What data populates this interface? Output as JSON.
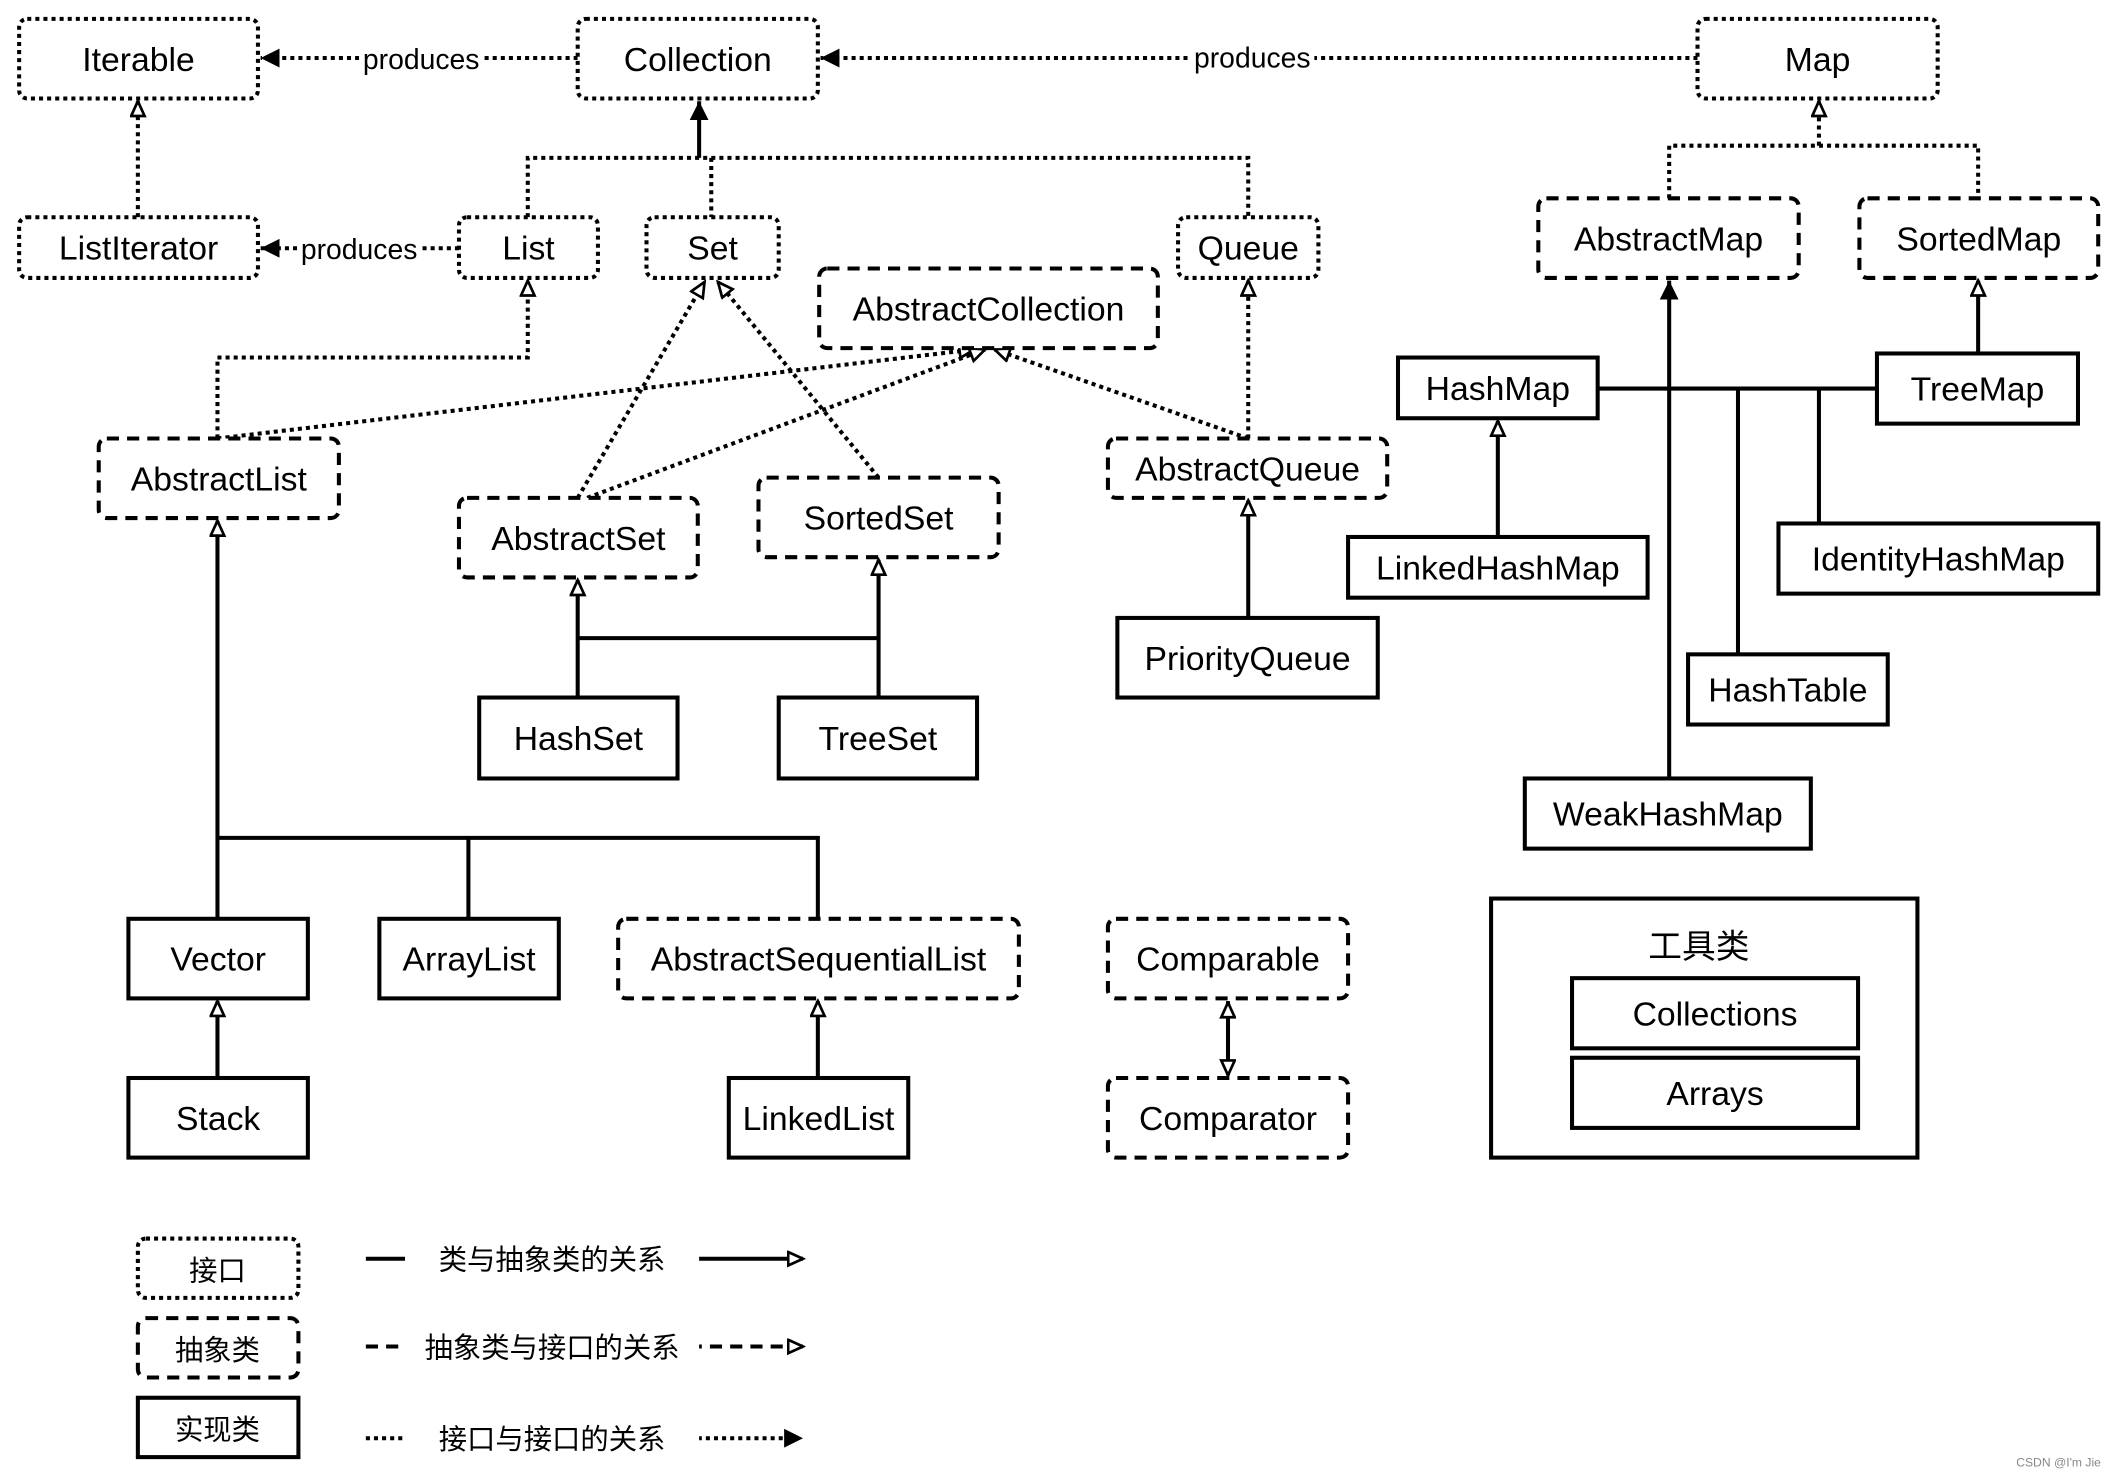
{
  "nodes": {
    "iterable": "Iterable",
    "collection": "Collection",
    "map": "Map",
    "listiterator": "ListIterator",
    "list": "List",
    "set": "Set",
    "queue": "Queue",
    "abstractcollection": "AbstractCollection",
    "abstractmap": "AbstractMap",
    "sortedmap": "SortedMap",
    "hashmap": "HashMap",
    "treemap": "TreeMap",
    "abstractlist": "AbstractList",
    "abstractset": "AbstractSet",
    "sortedset": "SortedSet",
    "abstractqueue": "AbstractQueue",
    "linkedhashmap": "LinkedHashMap",
    "identityhashmap": "IdentityHashMap",
    "priorityqueue": "PriorityQueue",
    "hashtable": "HashTable",
    "hashset": "HashSet",
    "treeset": "TreeSet",
    "weakhashmap": "WeakHashMap",
    "vector": "Vector",
    "arraylist": "ArrayList",
    "abstractsequentiallist": "AbstractSequentialList",
    "comparable": "Comparable",
    "stack": "Stack",
    "linkedlist": "LinkedList",
    "comparator": "Comparator",
    "collections": "Collections",
    "arrays": "Arrays"
  },
  "utility_group_title": "工具类",
  "edge_labels": {
    "collection_iterable": "produces",
    "map_collection": "produces",
    "list_listiterator": "produces"
  },
  "legend": {
    "interface": "接口",
    "abstract_class": "抽象类",
    "impl_class": "实现类",
    "class_abstract_relation": "类与抽象类的关系",
    "abstract_interface_relation": "抽象类与接口的关系",
    "interface_interface_relation": "接口与接口的关系"
  },
  "watermark": "CSDN @I'm Jie"
}
